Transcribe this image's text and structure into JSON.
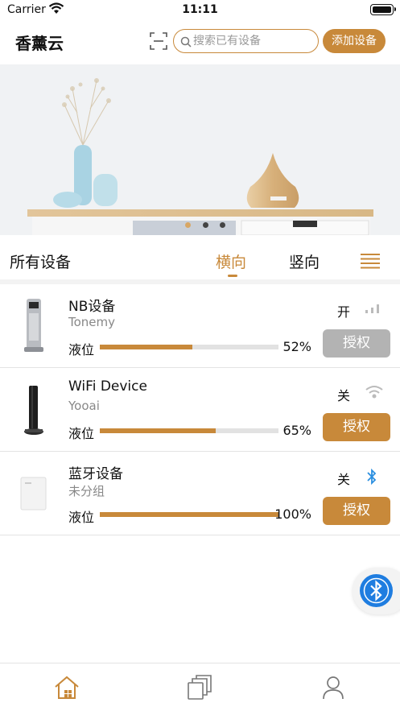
{
  "status_bar": {
    "carrier": "Carrier",
    "time": "11:11"
  },
  "header": {
    "title": "香薰云",
    "search_placeholder": "搜索已有设备",
    "add_device_label": "添加设备"
  },
  "banner": {
    "page_count": 3,
    "active_index": 0
  },
  "tabs": {
    "section_title": "所有设备",
    "horizontal_label": "横向",
    "vertical_label": "竖向",
    "active": "horizontal"
  },
  "devices": [
    {
      "name": "NB设备",
      "subtitle": "Tonemy",
      "level_label": "液位",
      "level_text": "52%",
      "level": 0.52,
      "state": "开",
      "connection_icon": "signal-icon",
      "auth_label": "授权",
      "auth_enabled": false
    },
    {
      "name": "WiFi Device",
      "subtitle": "Yooai",
      "level_label": "液位",
      "level_text": "65%",
      "level": 0.65,
      "state": "关",
      "connection_icon": "wifi-icon",
      "auth_label": "授权",
      "auth_enabled": true
    },
    {
      "name": "蓝牙设备",
      "subtitle": "未分组",
      "level_label": "液位",
      "level_text": "100%",
      "level": 1.0,
      "state": "关",
      "connection_icon": "bluetooth-icon",
      "auth_label": "授权",
      "auth_enabled": true
    }
  ],
  "tabbar": {
    "items": [
      "home-icon",
      "devices-icon",
      "profile-icon"
    ],
    "active_index": 0
  },
  "colors": {
    "accent": "#c8893a",
    "disabled": "#b3b3b3",
    "bluetooth": "#1f7de0",
    "banner_bg": "#f0f2f4"
  }
}
